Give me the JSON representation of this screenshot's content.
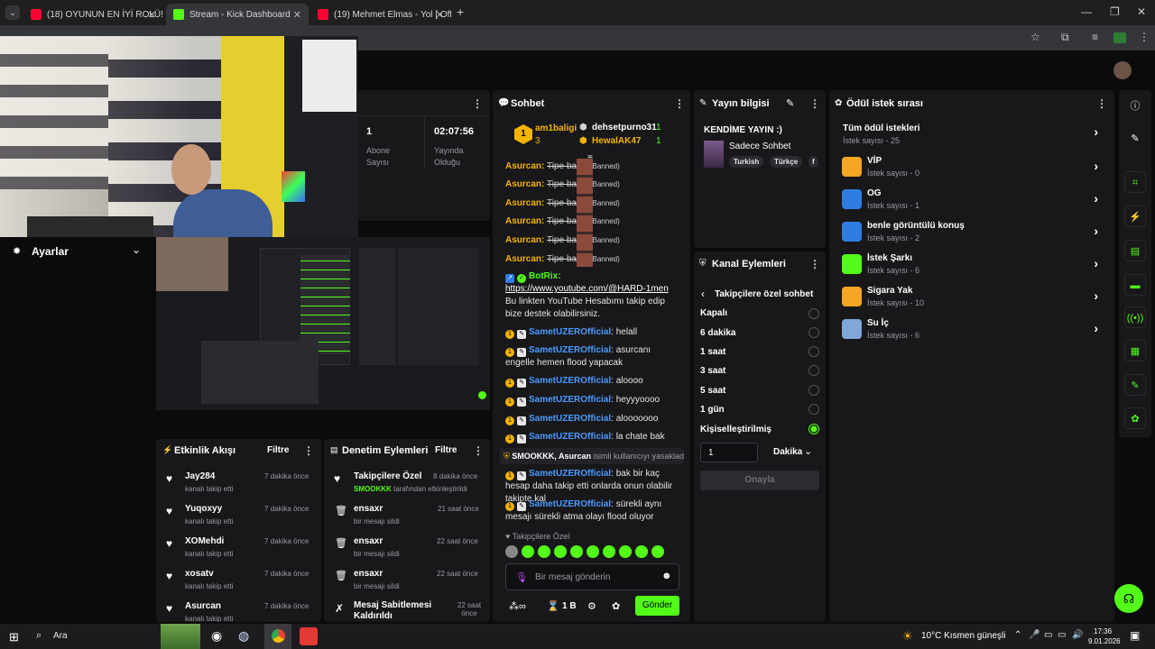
{
  "browser": {
    "tabs": [
      {
        "title": "(18) OYUNUN EN İYİ ROLÜ!! BO",
        "color": "#ff0033"
      },
      {
        "title": "Stream - Kick Dashboard",
        "color": "#53fc18"
      },
      {
        "title": "(19) Mehmet Elmas - Yol [ Offic",
        "color": "#ff0033"
      }
    ],
    "new_tab": "+"
  },
  "settings": {
    "label": "Ayarlar"
  },
  "stats": {
    "subs_value": "1",
    "subs_label": "Abone Sayısı",
    "uptime_value": "02:07:56",
    "uptime_label": "Yayında Olduğu"
  },
  "chat": {
    "title": "Sohbet",
    "top": [
      {
        "rank": "1",
        "name": "am1baligi",
        "count": "3"
      },
      {
        "name": "dehsetpurno31",
        "count": "1"
      },
      {
        "name": "HewalAK47",
        "count": "1"
      }
    ],
    "banned_user": "Asurcan:",
    "banned_text": "Tipe bak",
    "banned_tag": ":) (Banned)",
    "botrix_name": "BotRix:",
    "botrix_link": "https://www.youtube.com/@HARD-1men",
    "botrix_text": "Bu linkten YouTube Hesabımı takip edip bize destek olabilirsiniz.",
    "user": "SametUZEROfficial",
    "msgs": [
      ": helall",
      ": asurcanı engelle hemen flood yapacak",
      ": aloooo",
      ": heyyyoooo",
      ": alooooooo",
      ": la chate bak",
      ": bak bir kaç hesap daha takip etti onlarda onun olabilir takipte kal",
      ": sürekli aynı mesajı sürekli atma olayı flood oluyor"
    ],
    "ban_notice_names": "SMOOKKK, Asurcan",
    "ban_notice_text": " isimli kullanıcıyı yasakladı",
    "followers_only": "Takipçilere Özel",
    "input_placeholder": "Bir mesaj gönderin",
    "slow": "1 B",
    "send": "Gönder"
  },
  "stream_info": {
    "title": "Yayın bilgisi",
    "stream_title": "KENDİME YAYIN :)",
    "category": "Sadece Sohbet",
    "tags": [
      "Turkish",
      "Türkçe",
      "f"
    ]
  },
  "channel_actions": {
    "title": "Kanal Eylemleri",
    "back_label": "Takipçilere özel sohbet",
    "options": [
      "Kapalı",
      "6 dakika",
      "1 saat",
      "3 saat",
      "5 saat",
      "1 gün",
      "Kişiselleştirilmiş"
    ],
    "selected": 6,
    "custom_value": "1",
    "unit": "Dakika",
    "confirm": "Onayla"
  },
  "rewards": {
    "title": "Ödül istek sırası",
    "all_label": "Tüm ödül istekleri",
    "all_count": "İstek sayısı - 25",
    "items": [
      {
        "name": "VİP",
        "count": "İstek sayısı - 0",
        "color": "#f5a623"
      },
      {
        "name": "OG",
        "count": "İstek sayısı - 1",
        "color": "#2f7de1"
      },
      {
        "name": "benle görüntülü konuş",
        "count": "İstek sayısı - 2",
        "color": "#2f7de1"
      },
      {
        "name": "İstek Şarkı",
        "count": "İstek sayısı - 6",
        "color": "#53fc18"
      },
      {
        "name": "Sigara Yak",
        "count": "İstek sayısı - 10",
        "color": "#f5a623"
      },
      {
        "name": "Su İç",
        "count": "İstek sayısı - 6",
        "color": "#7fa8d8"
      }
    ]
  },
  "activity": {
    "title": "Etkinlik Akışı",
    "filter": "Filtre",
    "items": [
      {
        "name": "Jay284",
        "action": "kanalı takip etti",
        "time": "7 dakika önce"
      },
      {
        "name": "Yuqoxyy",
        "action": "kanalı takip etti",
        "time": "7 dakika önce"
      },
      {
        "name": "XOMehdi",
        "action": "kanalı takip etti",
        "time": "7 dakika önce"
      },
      {
        "name": "xosatv",
        "action": "kanalı takip etti",
        "time": "7 dakika önce"
      },
      {
        "name": "Asurcan",
        "action": "kanalı takip etti",
        "time": "7 dakika önce"
      }
    ]
  },
  "moderation": {
    "title": "Denetim Eylemleri",
    "filter": "Filtre",
    "items": [
      {
        "name": "Takipçilere Özel",
        "actor": "SMOOKKK",
        "action": " tarafından etkinleştirildi",
        "time": "8 dakika önce"
      },
      {
        "name": "ensaxr",
        "action": "bir mesajı sildi",
        "time": "21 saat önce"
      },
      {
        "name": "ensaxr",
        "action": "bir mesajı sildi",
        "time": "22 saat önce"
      },
      {
        "name": "ensaxr",
        "action": "bir mesajı sildi",
        "time": "22 saat önce"
      },
      {
        "name": "Mesaj Sabitlemesi Kaldırıldı",
        "time": "22 saat önce"
      }
    ]
  },
  "taskbar": {
    "search": "Ara",
    "weather": "10°C  Kısmen güneşli",
    "time": "17:36",
    "date": "9.01.2026"
  }
}
